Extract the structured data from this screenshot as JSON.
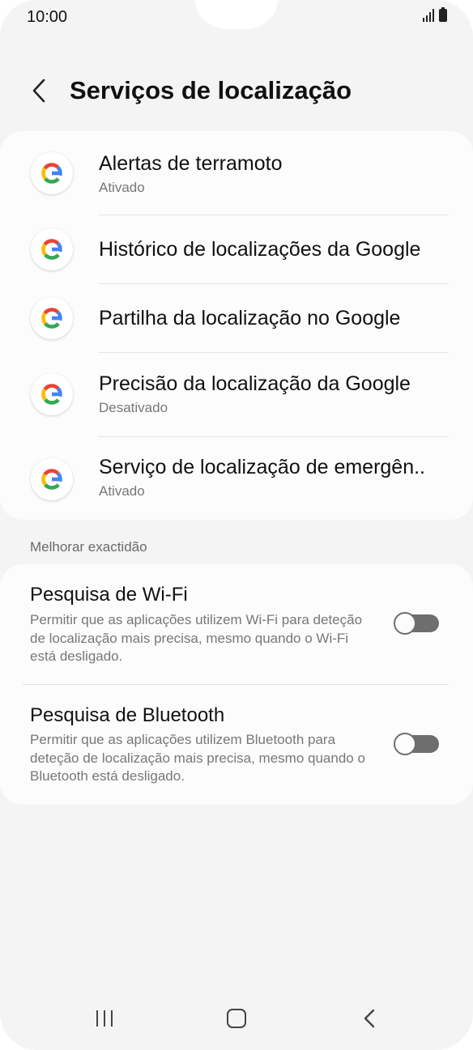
{
  "status_bar": {
    "time": "10:00",
    "icons": [
      "signal-icon",
      "battery-icon"
    ]
  },
  "header": {
    "back_icon": "chevron-left-icon",
    "title": "Serviços de localização"
  },
  "google_services": [
    {
      "title": "Alertas de terramoto",
      "subtitle": "Ativado",
      "icon": "google-icon"
    },
    {
      "title": "Histórico de localizações da Google",
      "subtitle": "",
      "icon": "google-icon"
    },
    {
      "title": "Partilha da localização no Google",
      "subtitle": "",
      "icon": "google-icon"
    },
    {
      "title": "Precisão da localização da Google",
      "subtitle": "Desativado",
      "icon": "google-icon"
    },
    {
      "title": "Serviço de localização de emergên..",
      "subtitle": "Ativado",
      "icon": "google-icon"
    }
  ],
  "accuracy_section": {
    "label": "Melhorar exactidão",
    "items": [
      {
        "title": "Pesquisa de Wi-Fi",
        "description": "Permitir que as aplicações utilizem Wi-Fi para deteção de localização mais precisa, mesmo quando o Wi-Fi está desligado.",
        "enabled": false
      },
      {
        "title": "Pesquisa de Bluetooth",
        "description": "Permitir que as aplicações utilizem Bluetooth para deteção de localização mais precisa, mesmo quando o Bluetooth está desligado.",
        "enabled": false
      }
    ]
  },
  "nav_bar": {
    "icons": [
      "recents-icon",
      "home-icon",
      "back-icon"
    ]
  },
  "colors": {
    "background": "#f4f4f4",
    "card": "#fcfcfc",
    "google_blue": "#4285F4",
    "google_red": "#EA4335",
    "google_yellow": "#FBBC05",
    "google_green": "#34A853",
    "toggle_off": "#6e6e6e"
  }
}
